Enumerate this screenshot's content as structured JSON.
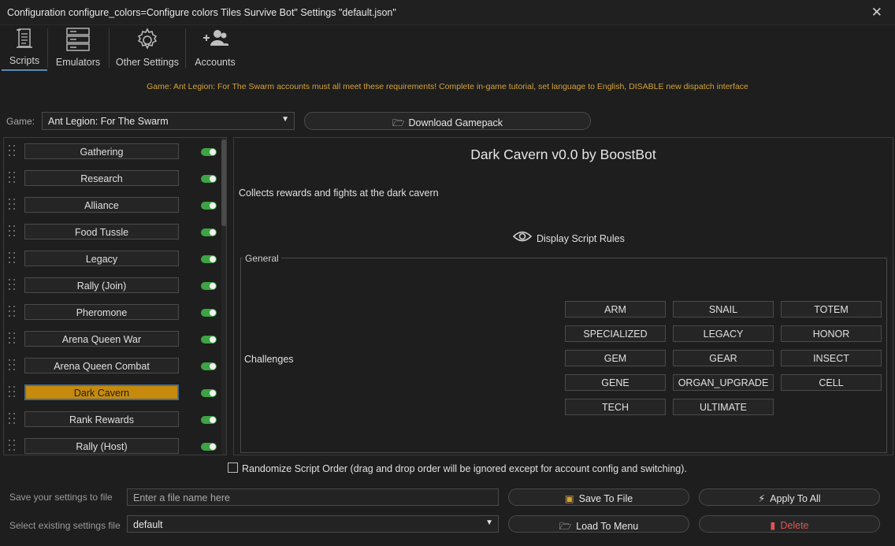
{
  "window": {
    "title": "Configuration configure_colors=Configure colors Tiles Survive Bot\" Settings \"default.json\"",
    "close_glyph": "✕"
  },
  "tabs": [
    {
      "label": "Scripts",
      "icon": "scroll-icon",
      "active": true
    },
    {
      "label": "Emulators",
      "icon": "server-icon",
      "active": false
    },
    {
      "label": "Other Settings",
      "icon": "gear-icon",
      "active": false
    },
    {
      "label": "Accounts",
      "icon": "users-add-icon",
      "active": false
    }
  ],
  "notice": "Game: Ant Legion: For The Swarm accounts must all meet these requirements! Complete in-game tutorial, set language to English, DISABLE new dispatch interface",
  "game": {
    "label": "Game:",
    "selected": "Ant Legion: For The Swarm",
    "download_label": "Download Gamepack"
  },
  "scripts": [
    {
      "label": "Gathering",
      "enabled": true,
      "selected": false
    },
    {
      "label": "Research",
      "enabled": true,
      "selected": false
    },
    {
      "label": "Alliance",
      "enabled": true,
      "selected": false
    },
    {
      "label": "Food Tussle",
      "enabled": true,
      "selected": false
    },
    {
      "label": "Legacy",
      "enabled": true,
      "selected": false
    },
    {
      "label": "Rally (Join)",
      "enabled": true,
      "selected": false
    },
    {
      "label": "Pheromone",
      "enabled": true,
      "selected": false
    },
    {
      "label": "Arena Queen War",
      "enabled": true,
      "selected": false
    },
    {
      "label": "Arena Queen Combat",
      "enabled": true,
      "selected": false
    },
    {
      "label": "Dark Cavern",
      "enabled": true,
      "selected": true
    },
    {
      "label": "Rank Rewards",
      "enabled": true,
      "selected": false
    },
    {
      "label": "Rally (Host)",
      "enabled": true,
      "selected": false
    }
  ],
  "detail": {
    "title": "Dark Cavern v0.0 by BoostBot",
    "description": "Collects rewards and fights at the dark cavern",
    "rules_label": "Display Script Rules",
    "group_label": "General",
    "challenges_label": "Challenges",
    "challenges": [
      "ARM",
      "SNAIL",
      "TOTEM",
      "SPECIALIZED",
      "LEGACY",
      "HONOR",
      "GEM",
      "GEAR",
      "INSECT",
      "GENE",
      "ORGAN_UPGRADE",
      "CELL",
      "TECH",
      "ULTIMATE"
    ]
  },
  "randomize_label": "Randomize Script Order (drag and drop order will be ignored except for account config and switching).",
  "footer": {
    "save_label": "Save your settings to file",
    "save_placeholder": "Enter a file name here",
    "select_label": "Select existing settings file",
    "select_value": "default",
    "save_to_file": "Save To File",
    "apply_to_all": "Apply To All",
    "load_to_menu": "Load To Menu",
    "delete": "Delete"
  },
  "colors": {
    "accent_selected": "#c78a0c",
    "toggle_on": "#3ea344",
    "notice": "#d4a23a",
    "delete_icon": "#e05555"
  }
}
